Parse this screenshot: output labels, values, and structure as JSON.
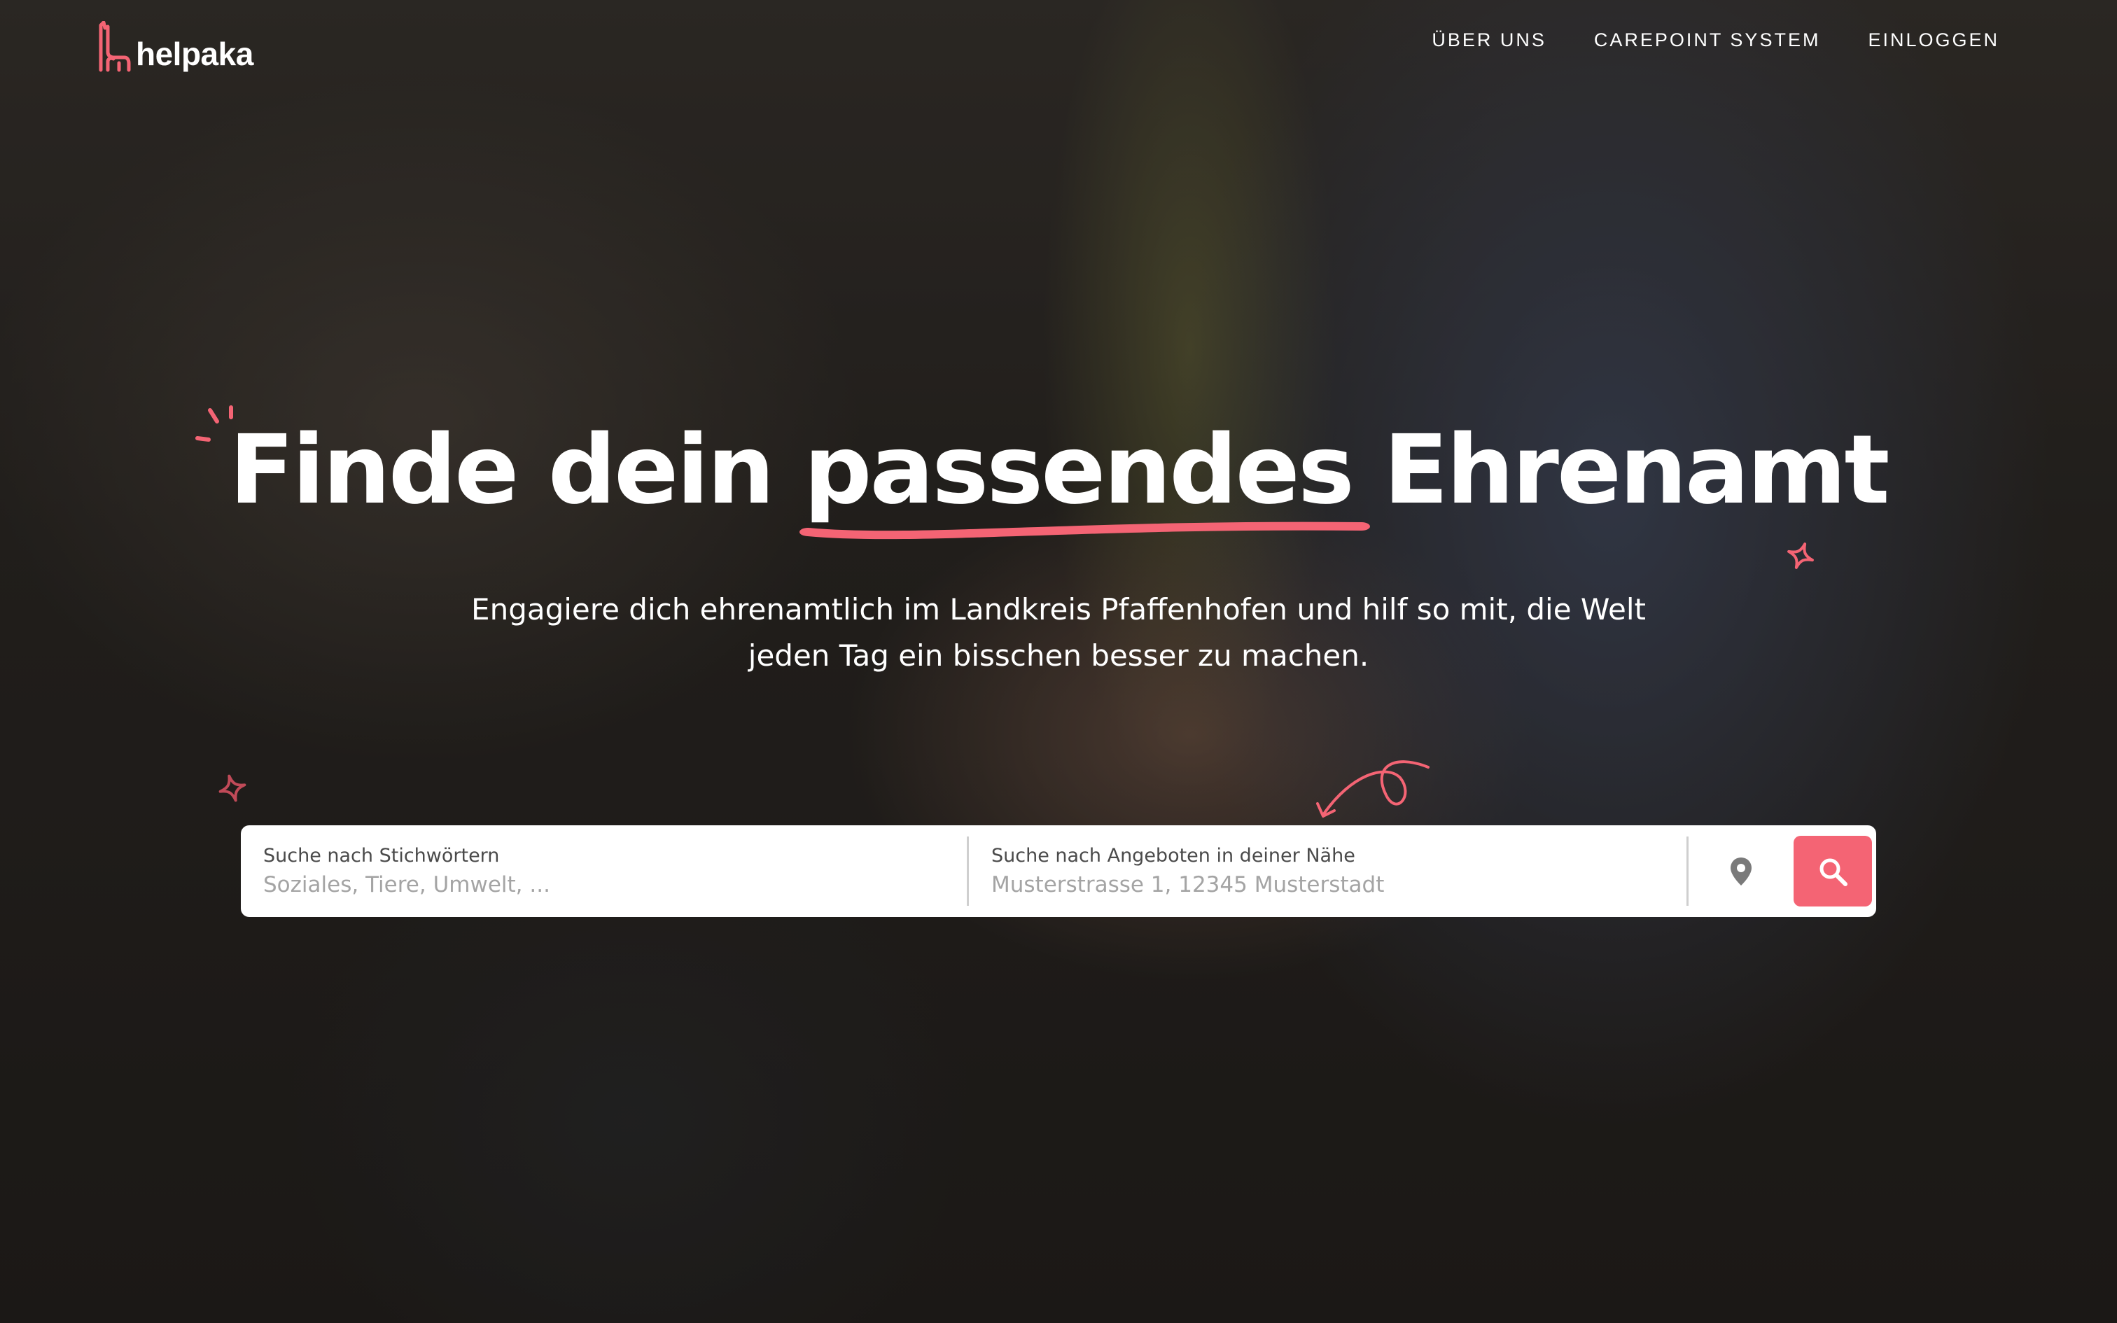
{
  "brand": {
    "name": "helpaka",
    "accent_color": "#f46474",
    "logo_icon": "llama-icon"
  },
  "nav": {
    "items": [
      {
        "label": "ÜBER UNS"
      },
      {
        "label": "CAREPOINT SYSTEM"
      },
      {
        "label": "EINLOGGEN"
      }
    ]
  },
  "hero": {
    "headline_before": "Finde dein ",
    "headline_highlight": "passendes",
    "headline_after": " Ehrenamt",
    "subline_line1": "Engagiere dich ehrenamtlich im Landkreis Pfaffenhofen und hilf so mit, die Welt",
    "subline_line2": "jeden Tag ein bisschen besser zu machen."
  },
  "search": {
    "keyword": {
      "label": "Suche nach Stichwörtern",
      "placeholder": "Soziales, Tiere, Umwelt, ...",
      "value": ""
    },
    "location": {
      "label": "Suche nach Angeboten in deiner Nähe",
      "placeholder": "Musterstrasse 1, 12345 Musterstadt",
      "value": ""
    },
    "location_icon": "map-pin-icon",
    "submit_icon": "search-icon"
  }
}
